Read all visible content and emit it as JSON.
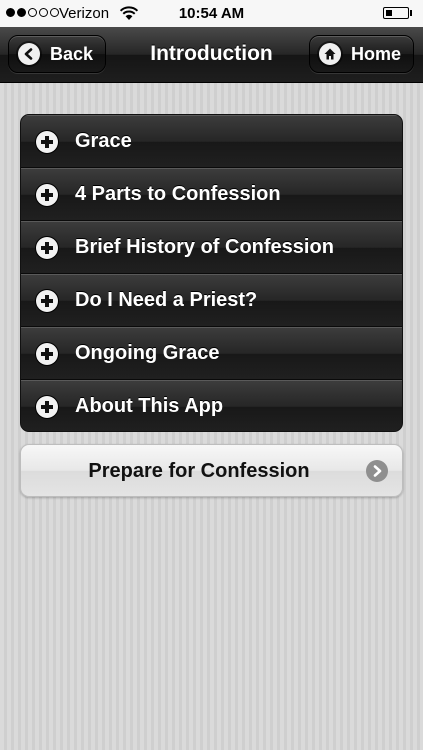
{
  "status_bar": {
    "signal_bars_filled": 2,
    "signal_bars_total": 5,
    "carrier": "Verizon",
    "time": "10:54 AM",
    "battery_level": 0.3,
    "icons": [
      "wifi-icon",
      "battery-icon"
    ]
  },
  "nav": {
    "title": "Introduction",
    "back_label": "Back",
    "home_label": "Home",
    "back_icon": "chevron-left-icon",
    "home_icon": "home-icon"
  },
  "accordion": {
    "icon": "plus-icon",
    "items": [
      {
        "label": "Grace"
      },
      {
        "label": "4 Parts to Confession"
      },
      {
        "label": "Brief History of Confession"
      },
      {
        "label": "Do I Need a Priest?"
      },
      {
        "label": "Ongoing Grace"
      },
      {
        "label": "About This App"
      }
    ]
  },
  "prepare_button": {
    "label": "Prepare for Confession",
    "icon": "chevron-right-icon"
  },
  "colors": {
    "nav_bar": "#262626",
    "list_item": "#222222",
    "background_stripes": "#d6d6d6",
    "prepare_button": "#e6e6e6",
    "chevron_circle": "#8f8f8f"
  }
}
